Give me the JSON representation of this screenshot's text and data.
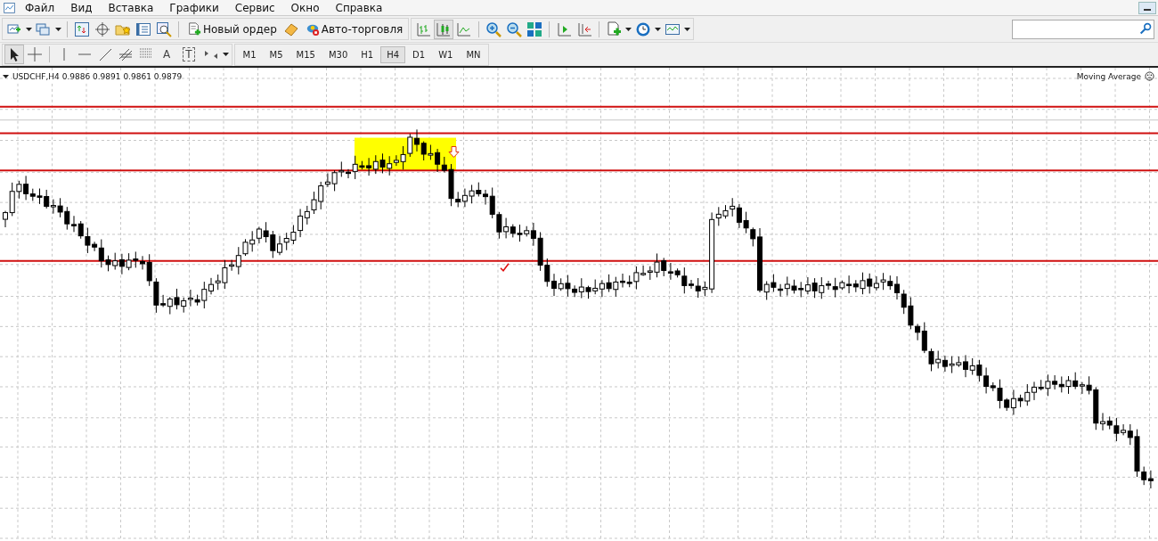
{
  "menu": [
    "Файл",
    "Вид",
    "Вставка",
    "Графики",
    "Сервис",
    "Окно",
    "Справка"
  ],
  "toolbar": {
    "new_order": "Новый ордер",
    "auto_trading": "Авто-торговля",
    "bar_chart_selected": false,
    "candlesticks_selected": true,
    "line_chart_selected": false
  },
  "drawing_tools": {
    "text": "A",
    "text_label": "T",
    "cursor_selected": true,
    "crosshair_selected": false
  },
  "timeframes": [
    {
      "label": "M1",
      "selected": false
    },
    {
      "label": "M5",
      "selected": false
    },
    {
      "label": "M15",
      "selected": false
    },
    {
      "label": "M30",
      "selected": false
    },
    {
      "label": "H1",
      "selected": false
    },
    {
      "label": "H4",
      "selected": true
    },
    {
      "label": "D1",
      "selected": false
    },
    {
      "label": "W1",
      "selected": false
    },
    {
      "label": "MN",
      "selected": false
    }
  ],
  "chart": {
    "symbol_info": "USDCHF,H4  0.9886 0.9891 0.9861 0.9879",
    "indicator": "Moving Average"
  }
}
